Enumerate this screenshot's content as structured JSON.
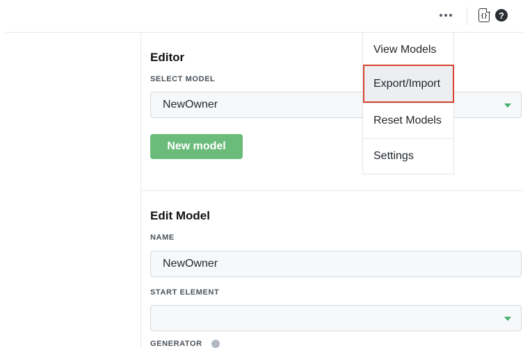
{
  "header": {
    "more_icon": "more-horizontal-icon",
    "json_icon": "json-file-icon",
    "json_glyph": "{}",
    "help_icon": "help-circle-icon",
    "help_glyph": "?"
  },
  "menu": {
    "items": [
      {
        "label": "View Models"
      },
      {
        "label": "Export/Import",
        "highlighted": true
      },
      {
        "label": "Reset Models"
      },
      {
        "label": "Settings"
      }
    ]
  },
  "editor": {
    "title": "Editor",
    "select_model_label": "SELECT MODEL",
    "select_model_value": "NewOwner",
    "new_model_button": "New model"
  },
  "edit_model": {
    "title": "Edit Model",
    "name_label": "NAME",
    "name_value": "NewOwner",
    "start_element_label": "START ELEMENT",
    "start_element_value": "",
    "generator_label": "GENERATOR"
  },
  "colors": {
    "accent_green": "#6bbb7b",
    "caret_green": "#3fb16a",
    "highlight_red": "#d9432f"
  }
}
